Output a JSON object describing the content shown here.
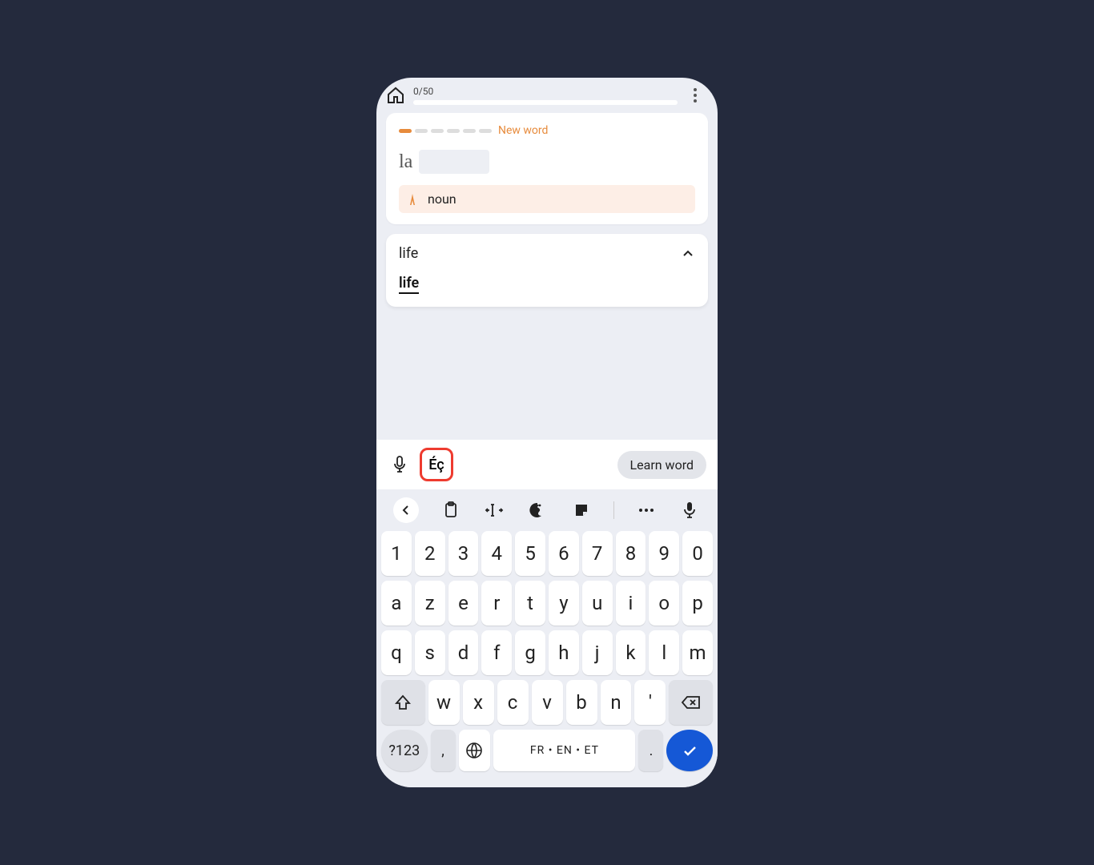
{
  "header": {
    "progress_label": "0/50"
  },
  "card": {
    "status_label": "New word",
    "article": "la",
    "pos_label": "noun"
  },
  "answer": {
    "title": "life",
    "option": "life"
  },
  "toolbar": {
    "accent_label": "Éç",
    "learn_label": "Learn word"
  },
  "keyboard": {
    "row1": [
      "1",
      "2",
      "3",
      "4",
      "5",
      "6",
      "7",
      "8",
      "9",
      "0"
    ],
    "row2": [
      "a",
      "z",
      "e",
      "r",
      "t",
      "y",
      "u",
      "i",
      "o",
      "p"
    ],
    "row3": [
      "q",
      "s",
      "d",
      "f",
      "g",
      "h",
      "j",
      "k",
      "l",
      "m"
    ],
    "row4": [
      "w",
      "x",
      "c",
      "v",
      "b",
      "n",
      "'"
    ],
    "num_label": "?123",
    "comma": ",",
    "period": ".",
    "space_label": "FR • EN • ET"
  }
}
